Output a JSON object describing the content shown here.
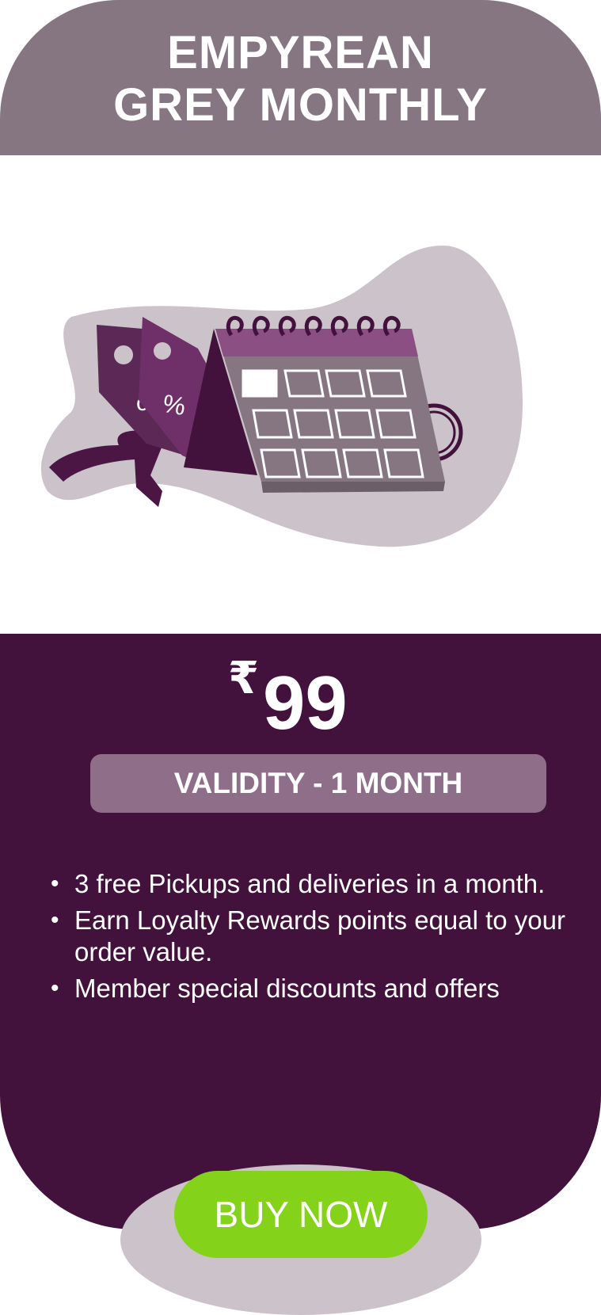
{
  "plan": {
    "title_line1": "EMPYREAN",
    "title_line2": "GREY MONTHLY",
    "currency_symbol": "₹",
    "price": "99",
    "validity": "VALIDITY - 1 MONTH",
    "features": [
      "3 free Pickups and deliveries in a month.",
      "Earn Loyalty Rewards points equal to your order value.",
      "Member special discounts and offers"
    ],
    "cta": "BUY NOW"
  },
  "colors": {
    "header": "#857682",
    "card": "#42123c",
    "validity_bg": "#8e6e89",
    "cta": "#84d31a",
    "blob": "#cbc3c9"
  },
  "illustration": {
    "icon": "calendar-with-discount-tags-icon",
    "tag_text": "%"
  }
}
